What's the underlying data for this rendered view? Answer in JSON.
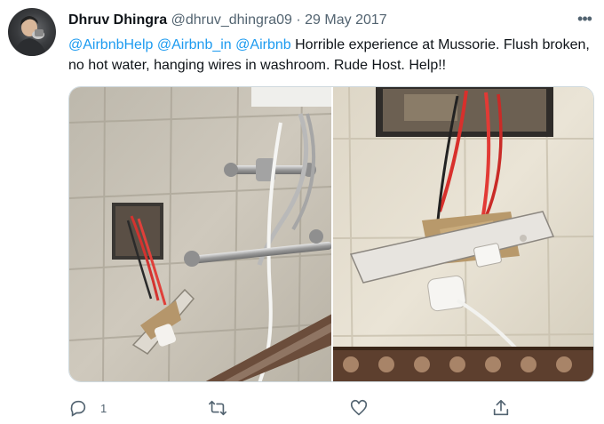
{
  "tweet": {
    "display_name": "Dhruv Dhingra",
    "handle": "@dhruv_dhingra09",
    "separator": "·",
    "date": "29 May 2017",
    "more_label": "•••",
    "mentions": [
      "@AirbnbHelp",
      "@Airbnb_in",
      "@Airbnb"
    ],
    "body": "Horrible experience at Mussorie. Flush broken, no hot water, hanging wires in washroom. Rude Host. Help!!"
  },
  "actions": {
    "reply_count": "1",
    "retweet_count": "",
    "like_count": ""
  },
  "icons": [
    "avatar-photo",
    "more-icon",
    "reply-icon",
    "retweet-icon",
    "like-icon",
    "share-icon"
  ],
  "colors": {
    "accent": "#1d9bf0",
    "text": "#0f1419",
    "secondary": "#536471",
    "border": "#cfd9de"
  }
}
